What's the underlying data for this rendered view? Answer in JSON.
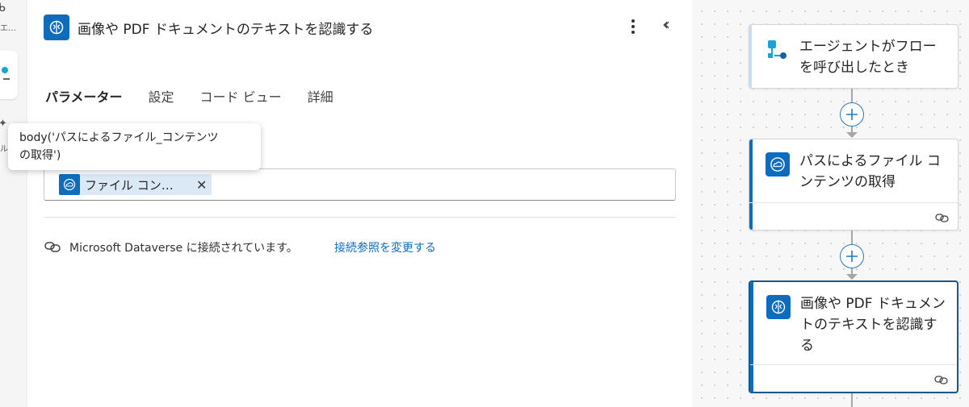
{
  "left_strip": {
    "top_glyph": "ᑲ",
    "top_text": "エ…",
    "ai_glyph": "✦",
    "ai_text": "ル"
  },
  "panel": {
    "title": "画像や PDF ドキュメントのテキストを認識する",
    "tabs": [
      {
        "label": "パラメーター",
        "active": true
      },
      {
        "label": "設定",
        "active": false
      },
      {
        "label": "コード ビュー",
        "active": false
      },
      {
        "label": "詳細",
        "active": false
      }
    ],
    "token_label": "ファイル コン…",
    "connection_text": "Microsoft Dataverse に接続されています。",
    "connection_link": "接続参照を変更する"
  },
  "tooltip": {
    "line1": "body('パスによるファイル_コンテンツ",
    "line2": "の取得')"
  },
  "flow": {
    "cards": [
      {
        "title": "エージェントがフローを呼び出したとき"
      },
      {
        "title": "パスによるファイル コンテンツの取得"
      },
      {
        "title": "画像や PDF ドキュメントのテキストを認識する"
      }
    ]
  },
  "colors": {
    "accent": "#0f6cbd",
    "link": "#0f6cbd",
    "selected_border": "#0f5a8f",
    "trigger_icon": "#1aa3d8"
  }
}
